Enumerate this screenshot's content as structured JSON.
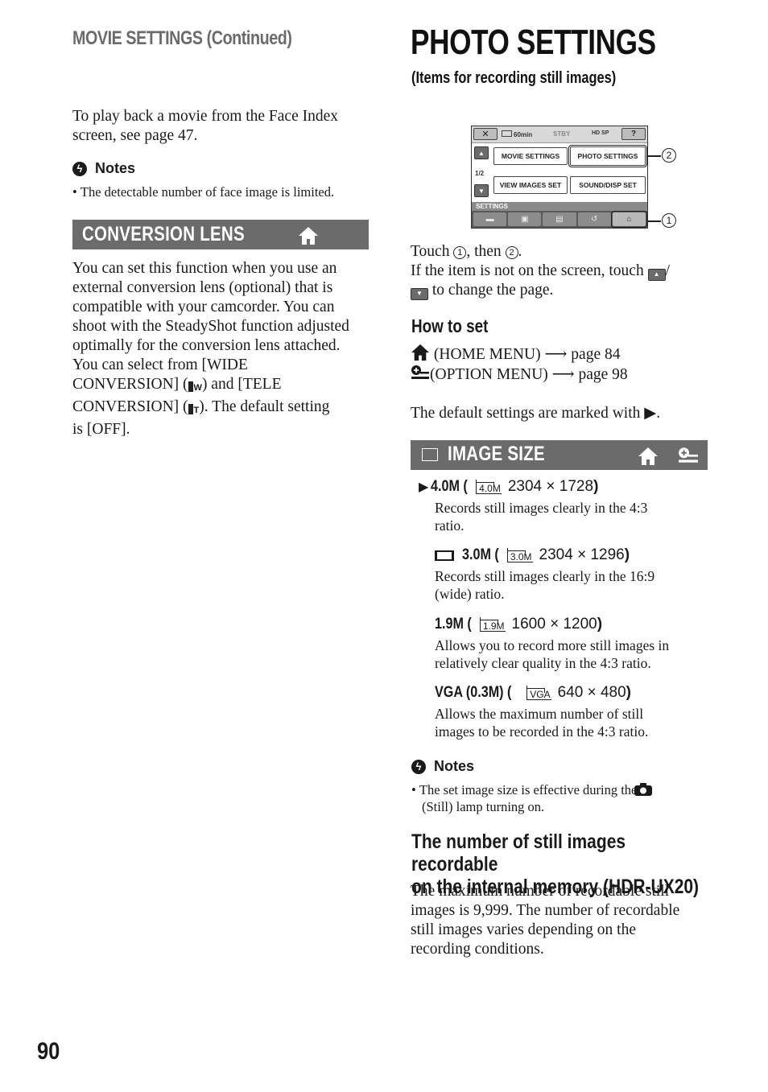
{
  "left_column": {
    "header": "MOVIE SETTINGS (Continued)",
    "intro_text": "To play back a movie from the Face Index screen, see page 47.",
    "notes": {
      "heading": "Notes",
      "icon": "notes-icon",
      "items": [
        "The detectable number of face image is limited."
      ]
    },
    "conversion_lens": {
      "title": "CONVERSION LENS",
      "icon": "home-icon",
      "body_lines": [
        "You can set this function when you use an",
        "external conversion lens (optional) that is",
        "compatible with your camcorder. You can",
        "shoot with the SteadyShot function adjusted",
        "optimally for the conversion lens attached.",
        "You can select from [WIDE"
      ],
      "line7_a": "CONVERSION] (",
      "line7_b": ") and [TELE",
      "line8_a": "CONVERSION] (",
      "line8_b": "). The default setting",
      "line9": "is [OFF].",
      "wide_icon_label": "W",
      "tele_icon_label": "T"
    }
  },
  "right_column": {
    "title": "PHOTO SETTINGS",
    "subtitle": "(Items for recording still images)",
    "screen": {
      "close_label": "✕",
      "battery_label": "60min",
      "status_label": "STBY",
      "quality_label": "HD SP",
      "help_label": "?",
      "page_indicator": "1/2",
      "buttons": [
        "MOVIE SETTINGS",
        "PHOTO SETTINGS",
        "VIEW IMAGES SET",
        "SOUND/DISP SET"
      ],
      "category_label": "SETTINGS",
      "callout_1": "1",
      "callout_2": "2"
    },
    "instructions": {
      "touch_a": "Touch ",
      "touch_b": ", then ",
      "touch_c": ".",
      "num1": "1",
      "num2": "2",
      "page_line_a": "If the item is not on the screen, touch ",
      "page_line_b": "/",
      "page_line_c": " to change the page."
    },
    "how_to_set": {
      "heading": "How to set",
      "home_line": "(HOME MENU) ",
      "home_page": " page 84",
      "option_line": "(OPTION MENU) ",
      "option_page": " page 98",
      "arrow": "⟶",
      "default_note": "The default settings are marked with ▶."
    },
    "image_size": {
      "title": "IMAGE SIZE",
      "items": [
        {
          "marker": "▶",
          "label": "4.0M (",
          "icon_text": "4.0M",
          "dims": "2304 × 1728",
          "close": ")",
          "desc_lines": [
            "Records still images clearly in the 4:3",
            "ratio."
          ]
        },
        {
          "marker": "wide",
          "label": "3.0M (",
          "icon_text": "3.0M",
          "dims": "2304 × 1296",
          "close": ")",
          "desc_lines": [
            "Records still images clearly in the 16:9",
            "(wide) ratio."
          ]
        },
        {
          "marker": "",
          "label": "1.9M (",
          "icon_text": "1.9M",
          "dims": "1600 × 1200",
          "close": ")",
          "desc_lines": [
            "Allows you to record more still images in",
            "relatively clear quality in the 4:3 ratio."
          ]
        },
        {
          "marker": "",
          "label": "VGA (0.3M) (",
          "icon_text": "VGA",
          "dims": "640 × 480",
          "close": ")",
          "desc_lines": [
            "Allows the maximum number of still",
            "images to be recorded in the 4:3 ratio."
          ]
        }
      ]
    },
    "notes": {
      "heading": "Notes",
      "item_a": "The set image size is effective during the",
      "item_b": "(Still) lamp turning on."
    },
    "still_images": {
      "heading_lines": [
        "The number of still images recordable",
        "on the internal memory (HDR-UX20)"
      ],
      "body_lines": [
        "The maximum number of recordable still",
        "images is 9,999. The number of recordable",
        "still images varies depending on the",
        "recording conditions."
      ]
    }
  },
  "page_number": "90"
}
